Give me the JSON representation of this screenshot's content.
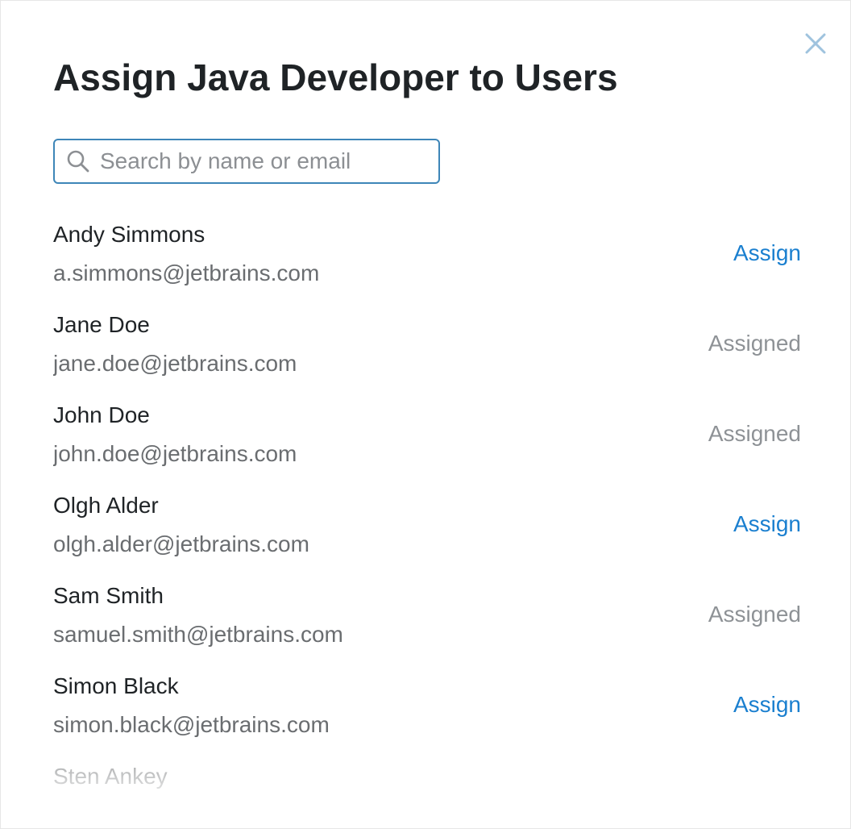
{
  "dialog": {
    "title": "Assign Java Developer to Users",
    "close_icon": "close-icon"
  },
  "search": {
    "placeholder": "Search by name or email",
    "value": "",
    "icon": "search-icon"
  },
  "colors": {
    "accent": "#1a7fcf",
    "assigned_text": "#8e9296",
    "search_border": "#3e86b8",
    "title_text": "#1f2326"
  },
  "users": [
    {
      "name": "Andy Simmons",
      "email": "a.simmons@jetbrains.com",
      "status": "assign",
      "action_label": "Assign"
    },
    {
      "name": "Jane Doe",
      "email": "jane.doe@jetbrains.com",
      "status": "assigned",
      "action_label": "Assigned"
    },
    {
      "name": "John Doe",
      "email": "john.doe@jetbrains.com",
      "status": "assigned",
      "action_label": "Assigned"
    },
    {
      "name": "Olgh Alder",
      "email": "olgh.alder@jetbrains.com",
      "status": "assign",
      "action_label": "Assign"
    },
    {
      "name": "Sam Smith",
      "email": "samuel.smith@jetbrains.com",
      "status": "assigned",
      "action_label": "Assigned"
    },
    {
      "name": "Simon Black",
      "email": "simon.black@jetbrains.com",
      "status": "assign",
      "action_label": "Assign"
    },
    {
      "name": "Sten Ankey",
      "email": "",
      "status": "",
      "action_label": ""
    }
  ]
}
